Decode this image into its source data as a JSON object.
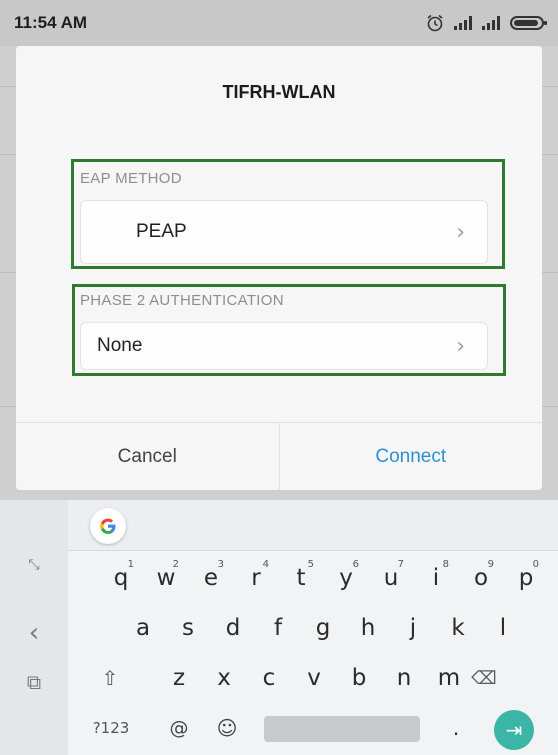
{
  "status_bar": {
    "time": "11:54 AM",
    "icons": [
      "alarm-icon",
      "signal-icon",
      "signal-icon",
      "battery-icon"
    ]
  },
  "dialog": {
    "title": "TIFRH-WLAN",
    "eap_method": {
      "label": "EAP METHOD",
      "value": "PEAP"
    },
    "phase2": {
      "label": "PHASE 2 AUTHENTICATION",
      "value": "None"
    },
    "cancel_label": "Cancel",
    "connect_label": "Connect",
    "highlight_color": "#2f7a2f",
    "connect_color": "#2d8fd5"
  },
  "keyboard": {
    "top_row": [
      {
        "key": "q",
        "hint": "1"
      },
      {
        "key": "w",
        "hint": "2"
      },
      {
        "key": "e",
        "hint": "3"
      },
      {
        "key": "r",
        "hint": "4"
      },
      {
        "key": "t",
        "hint": "5"
      },
      {
        "key": "y",
        "hint": "6"
      },
      {
        "key": "u",
        "hint": "7"
      },
      {
        "key": "i",
        "hint": "8"
      },
      {
        "key": "o",
        "hint": "9"
      },
      {
        "key": "p",
        "hint": "0"
      }
    ],
    "middle_row": [
      "a",
      "s",
      "d",
      "f",
      "g",
      "h",
      "j",
      "k",
      "l"
    ],
    "bottom_row": [
      "z",
      "x",
      "c",
      "v",
      "b",
      "n",
      "m"
    ],
    "symbols_label": "?123",
    "at_label": "@",
    "period_label": ".",
    "enter_color": "#3ab5a6"
  }
}
